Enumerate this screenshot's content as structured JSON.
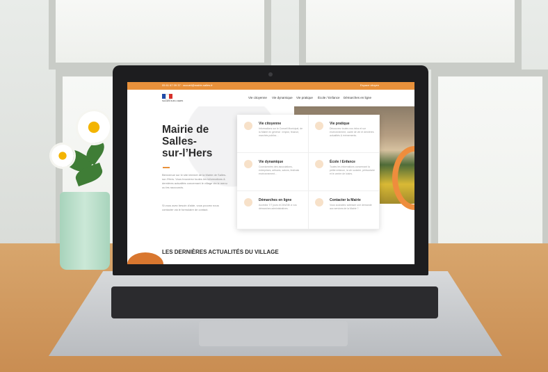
{
  "topbar": {
    "left_text": "05 61 67 09 37 · accueil@mairie-salles.fr",
    "right_text": "Espace citoyen"
  },
  "logo": {
    "text": "SALLES-SUR-L'HERS"
  },
  "nav": {
    "items": [
      "Vie citoyenne",
      "Vie dynamique",
      "Vie pratique",
      "École / Enfance",
      "Démarches en ligne"
    ]
  },
  "hero": {
    "title_lines": [
      "Mairie de",
      "Salles-",
      "sur-l’Hers"
    ],
    "paragraph1": "Bienvenue sur le site internet de la Mairie de Salles-sur-l'Hers. Vous trouverez toutes les informations & dernières actualités concernant le village via le menu ou les raccourcis.",
    "paragraph2": "Si vous avez besoin d'aide, vous pouvez nous contacter via le formulaire de contact."
  },
  "cards": [
    {
      "title": "Vie citoyenne",
      "desc": "Informations sur le Conseil Municipal, de la Mairie en général : emploi, finance, marchés publics…",
      "icon": "people-icon"
    },
    {
      "title": "Vie pratique",
      "desc": "Découvrez toutes nos infos et sur environnement, cadre de vie et dernières actualités & évènements.",
      "icon": "house-icon"
    },
    {
      "title": "Vie dynamique",
      "desc": "Coordonnées des associations, entreprises, artisans, salons, festivals environnement…",
      "icon": "handshake-icon"
    },
    {
      "title": "École / Enfance",
      "desc": "Toutes les informations concernant la petite enfance, la vie scolaire, périscolaire et le centre de loisirs.",
      "icon": "school-icon"
    },
    {
      "title": "Démarches en ligne",
      "desc": "Accédez 7/7 jours et 24h/24h à vos démarches administratives.",
      "icon": "laptop-icon"
    },
    {
      "title": "Contacter la Mairie",
      "desc": "Vous souhaitez adresser une demande aux services de la Mairie ?",
      "icon": "mail-icon"
    }
  ],
  "news": {
    "heading": "LES DERNIÈRES ACTUALITÉS DU VILLAGE"
  }
}
